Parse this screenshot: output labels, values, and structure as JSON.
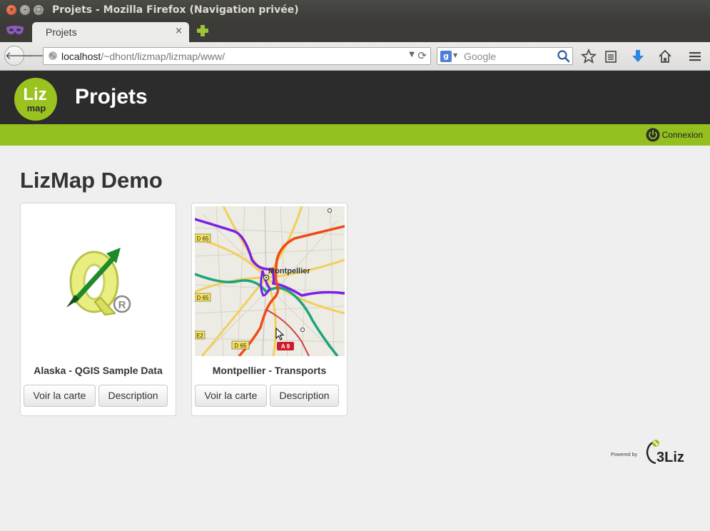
{
  "window": {
    "title": "Projets - Mozilla Firefox (Navigation privée)",
    "controls": [
      "×",
      "–",
      "□"
    ]
  },
  "tabs": [
    {
      "label": "Projets",
      "close": "×"
    }
  ],
  "navigation": {
    "back": "🡐",
    "forward": "🡒",
    "url_host": "localhost",
    "url_path": "/~dhont/lizmap/lizmap/www/",
    "url_dropdown": "▼",
    "reload": "⟳",
    "search_engine_letter": "g",
    "search_dropdown": "▼",
    "search_placeholder": "Google"
  },
  "site": {
    "logo_text_top": "Liz",
    "logo_text_bottom": "map",
    "title": "Projets",
    "login_label": "Connexion",
    "accent_color": "#93c01f",
    "header_color": "#2c2c2c"
  },
  "main": {
    "section_title": "LizMap Demo",
    "projects": [
      {
        "title": "Alaska - QGIS Sample Data",
        "view_label": "Voir la carte",
        "description_label": "Description",
        "thumbnail_icon": "qgis-logo-icon"
      },
      {
        "title": "Montpellier - Transports",
        "view_label": "Voir la carte",
        "description_label": "Description",
        "thumbnail_icon": "map-thumbnail",
        "map_labels": {
          "city": "Montpellier",
          "roads": [
            "D 65",
            "D 65",
            "E2",
            "D 65",
            "A 9"
          ]
        }
      }
    ]
  },
  "footer": {
    "powered_by": "Powered by",
    "brand": "3Liz"
  }
}
